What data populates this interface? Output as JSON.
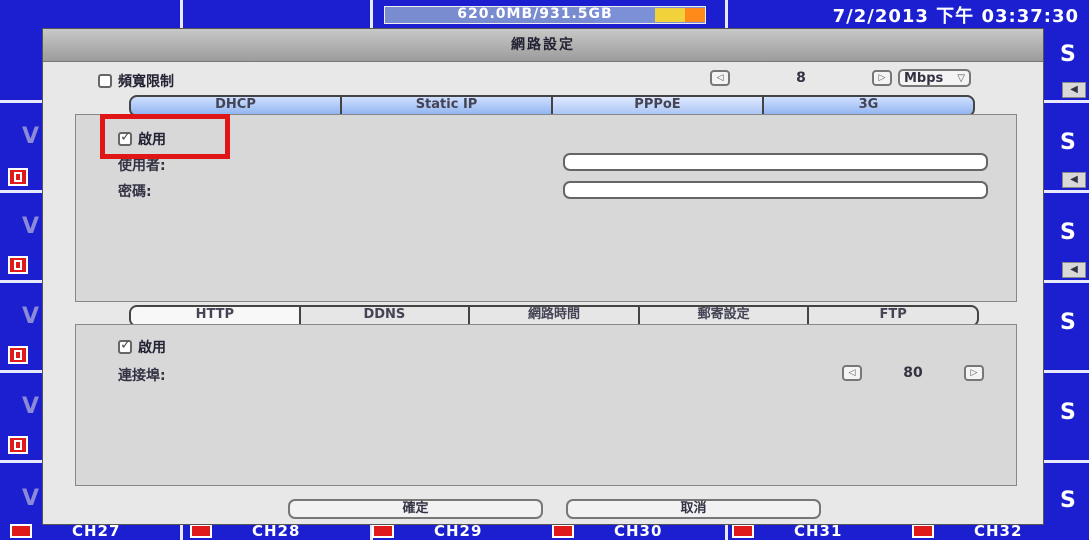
{
  "status_bar": {
    "storage": "620.0MB/931.5GB",
    "datetime": "7/2/2013 下午 03:37:30"
  },
  "background": {
    "channels": [
      "CH27",
      "CH28",
      "CH29",
      "CH30",
      "CH31",
      "CH32"
    ]
  },
  "dialog": {
    "title": "網路設定",
    "bandwidth_limit": {
      "label": "頻寬限制",
      "checked": false,
      "value": "8",
      "unit": "Mbps"
    },
    "connection_tabs": [
      "DHCP",
      "Static IP",
      "PPPoE",
      "3G"
    ],
    "connection_active_tab": "PPPoE",
    "pppoe": {
      "enable_label": "啟用",
      "enable_checked": true,
      "username_label": "使用者:",
      "username_value": "",
      "password_label": "密碼:",
      "password_value": ""
    },
    "service_tabs": [
      "HTTP",
      "DDNS",
      "網路時間",
      "郵寄設定",
      "FTP"
    ],
    "service_active_tab": "HTTP",
    "http": {
      "enable_label": "啟用",
      "enable_checked": true,
      "port_label": "連接埠:",
      "port_value": "80"
    },
    "ok_label": "確定",
    "cancel_label": "取消"
  },
  "colors": {
    "background": "#1b1fd0",
    "highlight": "#e01515"
  }
}
